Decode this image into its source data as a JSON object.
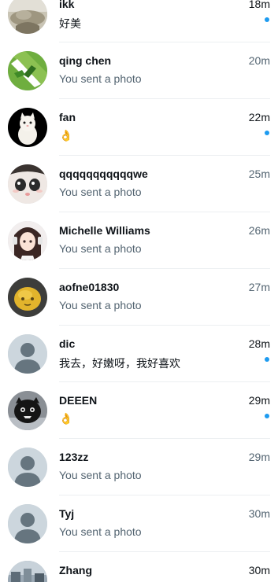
{
  "accent_color": "#1d9bf0",
  "conversations": [
    {
      "name": "ikk",
      "time": "18m",
      "preview": "好美",
      "unread": true,
      "avatar": "landscape-photo-avatar"
    },
    {
      "name": "qing chen",
      "time": "20m",
      "preview": "You sent a photo",
      "unread": false,
      "avatar": "green-logo-avatar"
    },
    {
      "name": "fan",
      "time": "22m",
      "preview": "👌",
      "unread": true,
      "avatar": "white-cat-avatar"
    },
    {
      "name": "qqqqqqqqqqqwe",
      "time": "25m",
      "preview": "You sent a photo",
      "unread": false,
      "avatar": "cartoon-face-avatar"
    },
    {
      "name": "Michelle Williams",
      "time": "26m",
      "preview": "You sent a photo",
      "unread": false,
      "avatar": "anime-girl-avatar"
    },
    {
      "name": "aofne01830",
      "time": "27m",
      "preview": "You sent a photo",
      "unread": false,
      "avatar": "yellow-blob-avatar"
    },
    {
      "name": "dic",
      "time": "28m",
      "preview": "我去，好嫩呀，我好喜欢",
      "unread": true,
      "avatar": "default-person-avatar"
    },
    {
      "name": "DEEEN",
      "time": "29m",
      "preview": "👌",
      "unread": true,
      "avatar": "black-creature-avatar"
    },
    {
      "name": "123zz",
      "time": "29m",
      "preview": "You sent a photo",
      "unread": false,
      "avatar": "default-person-avatar"
    },
    {
      "name": "Tyj",
      "time": "30m",
      "preview": "You sent a photo",
      "unread": false,
      "avatar": "default-person-avatar"
    },
    {
      "name": "Zhang",
      "time": "30m",
      "preview": "",
      "unread": false,
      "avatar": "street-photo-avatar"
    }
  ]
}
